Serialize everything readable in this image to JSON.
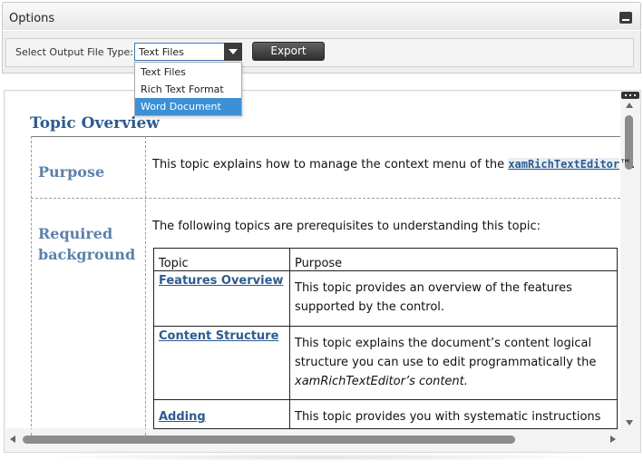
{
  "options_panel": {
    "title": "Options",
    "select_label": "Select Output File Type:",
    "selected_value": "Text Files",
    "dropdown_options": [
      "Text Files",
      "Rich Text Format",
      "Word Document"
    ],
    "highlighted_option": "Word Document",
    "export_label": "Export"
  },
  "document": {
    "heading": "Topic Overview",
    "purpose_label": "Purpose",
    "purpose_text_before": "This topic explains how to manage the context menu of the ",
    "purpose_link": "xamRichTextEditor",
    "purpose_text_after": "™.",
    "required_label_line1": "Required",
    "required_label_line2": "background",
    "prereq_intro": "The following topics are prerequisites to understanding this topic:",
    "prereq_table": {
      "headers": [
        "Topic",
        "Purpose"
      ],
      "rows": [
        {
          "topic": "Features Overview",
          "purpose_line1": "This topic provides an overview of the features",
          "purpose_line2": "supported by the control.",
          "purpose_line3": ""
        },
        {
          "topic": "Content Structure",
          "purpose_line1": "This topic explains the document’s content logical",
          "purpose_line2": "structure you can use to edit programmatically the",
          "purpose_line3": "xamRichTextEditor’s content."
        },
        {
          "topic": "Adding",
          "purpose_line1": "This topic provides you with systematic instructions",
          "purpose_line2": "",
          "purpose_line3": ""
        }
      ]
    }
  },
  "colors": {
    "accent_blue": "#2d5b8f",
    "section_label_blue": "#5b82aa",
    "selection_blue": "#3c91d6",
    "button_dark": "#3c3c3c"
  },
  "icons": {
    "collapse": "minimize-icon",
    "dropdown": "chevron-down-icon",
    "menu": "more-dots-icon",
    "scroll_up": "arrow-up-icon",
    "scroll_down": "arrow-down-icon",
    "scroll_left": "arrow-left-icon",
    "scroll_right": "arrow-right-icon"
  }
}
